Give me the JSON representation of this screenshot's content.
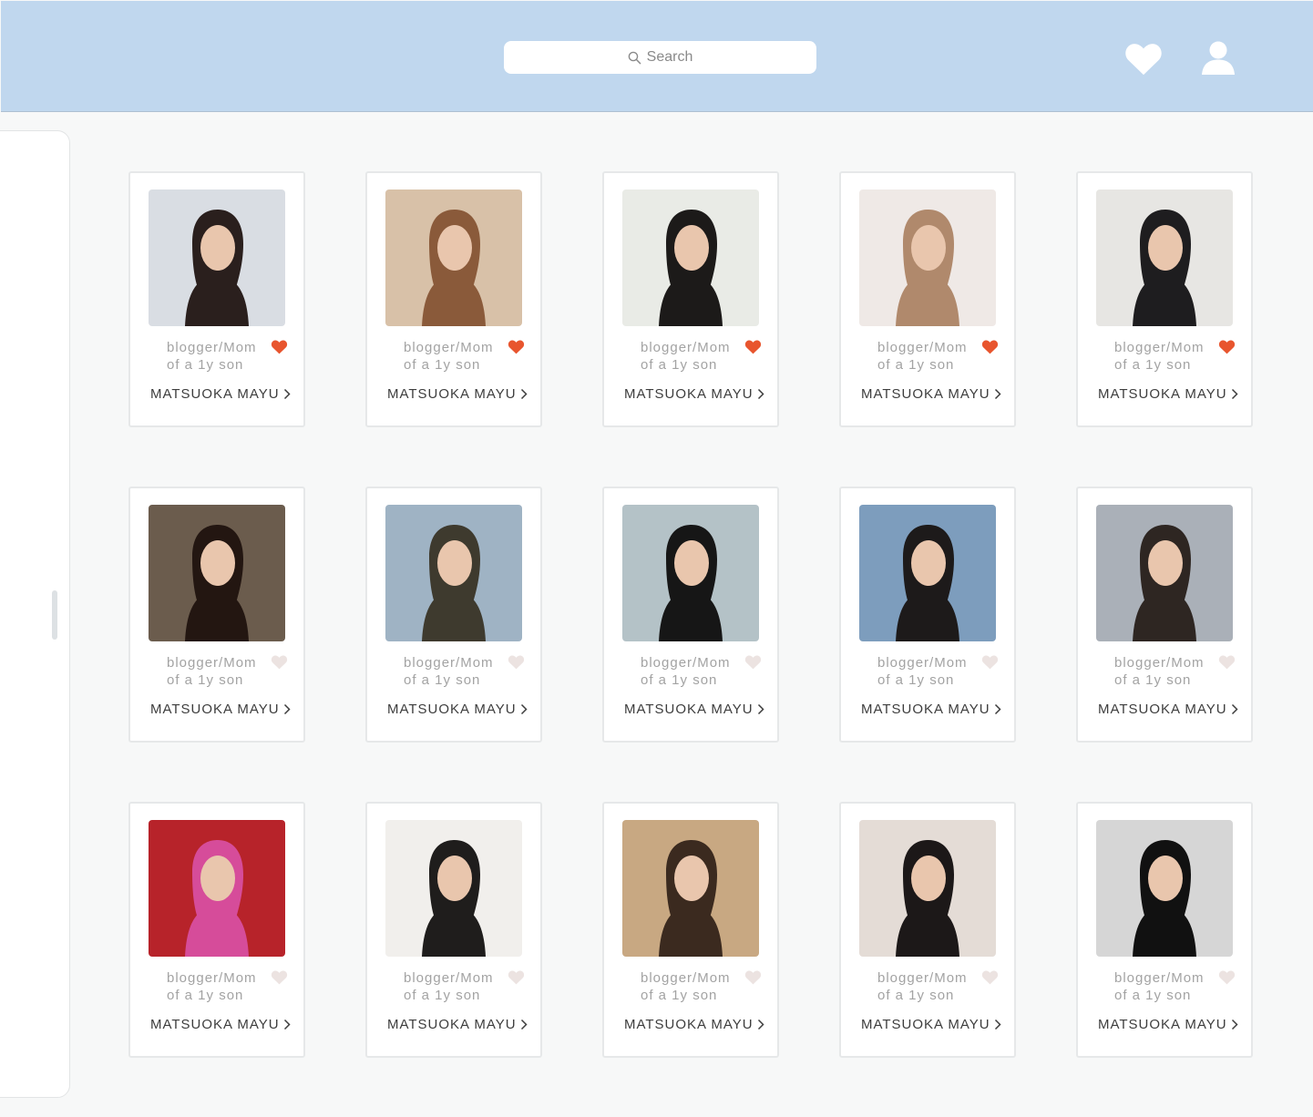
{
  "header": {
    "search_placeholder": "Search",
    "search_icon": "search-icon",
    "favorites_icon": "heart-icon",
    "profile_icon": "user-icon",
    "bar_color": "#c0d7ee"
  },
  "colors": {
    "favorited": "#e8552e",
    "not_favorited": "#ece3e1"
  },
  "profiles": [
    {
      "bio_line1": "blogger/Mom",
      "bio_line2": "of a 1y son",
      "name": "MATSUOKA MAYU",
      "favorited": true,
      "photo_bg": "#d9dde3",
      "photo_fg": "#2a1f1d"
    },
    {
      "bio_line1": "blogger/Mom",
      "bio_line2": "of a 1y son",
      "name": "MATSUOKA MAYU",
      "favorited": true,
      "photo_bg": "#d8c1a8",
      "photo_fg": "#8a5a3a"
    },
    {
      "bio_line1": "blogger/Mom",
      "bio_line2": "of a 1y son",
      "name": "MATSUOKA MAYU",
      "favorited": true,
      "photo_bg": "#e9ebe6",
      "photo_fg": "#1c1a19"
    },
    {
      "bio_line1": "blogger/Mom",
      "bio_line2": "of a 1y son",
      "name": "MATSUOKA MAYU",
      "favorited": true,
      "photo_bg": "#efe9e6",
      "photo_fg": "#b0896c"
    },
    {
      "bio_line1": "blogger/Mom",
      "bio_line2": "of a 1y son",
      "name": "MATSUOKA MAYU",
      "favorited": true,
      "photo_bg": "#e7e6e3",
      "photo_fg": "#1e1d1f"
    },
    {
      "bio_line1": "blogger/Mom",
      "bio_line2": "of a 1y son",
      "name": "MATSUOKA MAYU",
      "favorited": false,
      "photo_bg": "#6b5c4d",
      "photo_fg": "#231611"
    },
    {
      "bio_line1": "blogger/Mom",
      "bio_line2": "of a 1y son",
      "name": "MATSUOKA MAYU",
      "favorited": false,
      "photo_bg": "#9fb3c4",
      "photo_fg": "#3e3a2e"
    },
    {
      "bio_line1": "blogger/Mom",
      "bio_line2": "of a 1y son",
      "name": "MATSUOKA MAYU",
      "favorited": false,
      "photo_bg": "#b4c2c7",
      "photo_fg": "#161616"
    },
    {
      "bio_line1": "blogger/Mom",
      "bio_line2": "of a 1y son",
      "name": "MATSUOKA MAYU",
      "favorited": false,
      "photo_bg": "#7d9dbd",
      "photo_fg": "#1d1a1a"
    },
    {
      "bio_line1": "blogger/Mom",
      "bio_line2": "of a 1y son",
      "name": "MATSUOKA MAYU",
      "favorited": false,
      "photo_bg": "#aab0b8",
      "photo_fg": "#2e2622"
    },
    {
      "bio_line1": "blogger/Mom",
      "bio_line2": "of a 1y son",
      "name": "MATSUOKA MAYU",
      "favorited": false,
      "photo_bg": "#b7232a",
      "photo_fg": "#d64c9a"
    },
    {
      "bio_line1": "blogger/Mom",
      "bio_line2": "of a 1y son",
      "name": "MATSUOKA MAYU",
      "favorited": false,
      "photo_bg": "#f1efec",
      "photo_fg": "#1f1d1c"
    },
    {
      "bio_line1": "blogger/Mom",
      "bio_line2": "of a 1y son",
      "name": "MATSUOKA MAYU",
      "favorited": false,
      "photo_bg": "#c8a882",
      "photo_fg": "#3b2a1f"
    },
    {
      "bio_line1": "blogger/Mom",
      "bio_line2": "of a 1y son",
      "name": "MATSUOKA MAYU",
      "favorited": false,
      "photo_bg": "#e4dcd6",
      "photo_fg": "#1c1818"
    },
    {
      "bio_line1": "blogger/Mom",
      "bio_line2": "of a 1y son",
      "name": "MATSUOKA MAYU",
      "favorited": false,
      "photo_bg": "#d6d6d6",
      "photo_fg": "#111111"
    }
  ]
}
